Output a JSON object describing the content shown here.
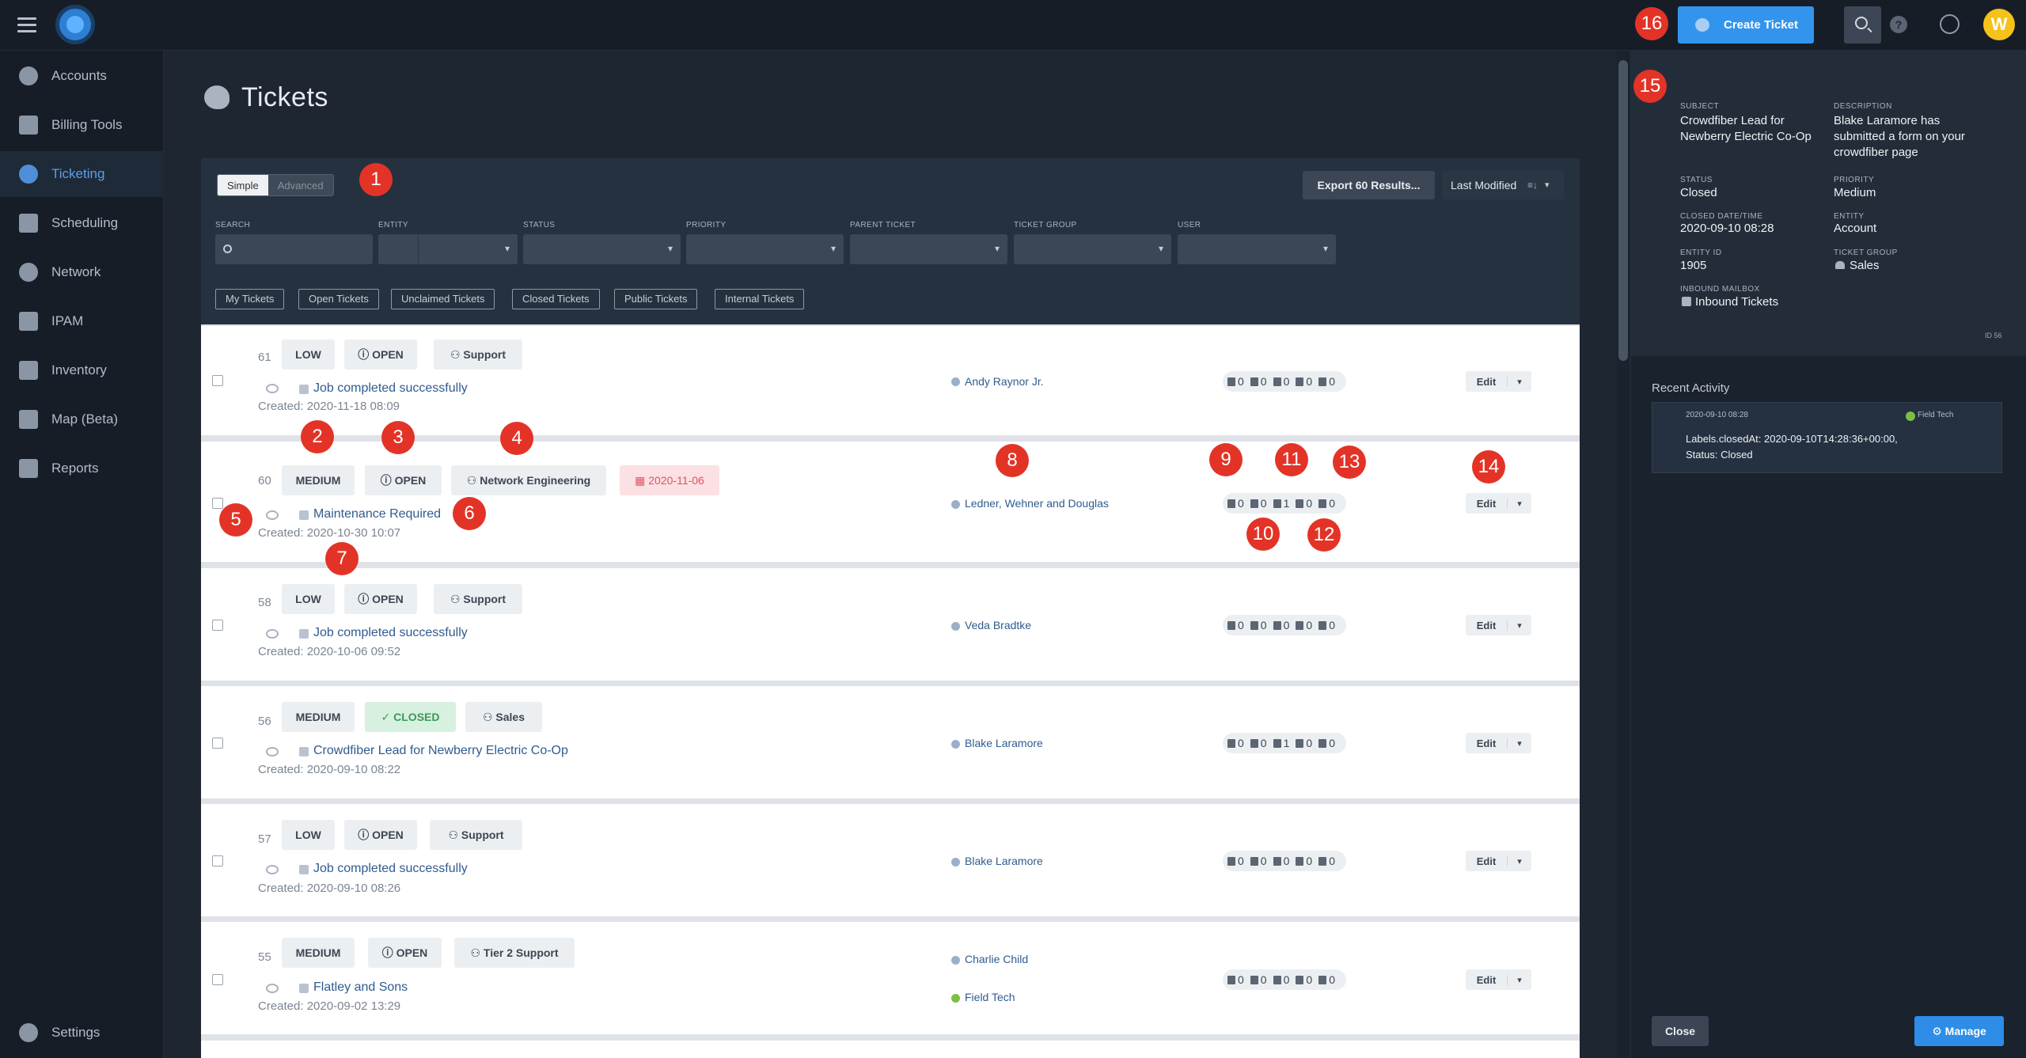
{
  "sidebar": {
    "items": [
      {
        "label": "Accounts",
        "icon": "accounts-icon"
      },
      {
        "label": "Billing Tools",
        "icon": "billing-icon"
      },
      {
        "label": "Ticketing",
        "icon": "ticketing-icon",
        "active": true
      },
      {
        "label": "Scheduling",
        "icon": "calendar-icon"
      },
      {
        "label": "Network",
        "icon": "network-icon"
      },
      {
        "label": "IPAM",
        "icon": "ipam-icon"
      },
      {
        "label": "Inventory",
        "icon": "inventory-icon"
      },
      {
        "label": "Map (Beta)",
        "icon": "map-icon"
      },
      {
        "label": "Reports",
        "icon": "reports-icon"
      }
    ],
    "settings_label": "Settings"
  },
  "header": {
    "create_label": "Create Ticket",
    "avatar_initial": "W"
  },
  "page": {
    "title": "Tickets"
  },
  "filters": {
    "mode_simple": "Simple",
    "mode_advanced": "Advanced",
    "export_label": "Export 60 Results...",
    "sort_label": "Last Modified",
    "labels": [
      "SEARCH",
      "ENTITY",
      "STATUS",
      "PRIORITY",
      "PARENT TICKET",
      "TICKET GROUP",
      "USER"
    ],
    "chips": [
      "My Tickets",
      "Open Tickets",
      "Unclaimed Tickets",
      "Closed Tickets",
      "Public Tickets",
      "Internal Tickets"
    ]
  },
  "tickets": [
    {
      "id": "61",
      "priority": "LOW",
      "status": "OPEN",
      "group": "Support",
      "subject": "Job completed successfully",
      "created": "Created: 2020-11-18 08:09",
      "assignee": "Andy Raynor Jr.",
      "counts": [
        "0",
        "0",
        "0",
        "0",
        "0"
      ]
    },
    {
      "id": "60",
      "priority": "MEDIUM",
      "status": "OPEN",
      "group": "Network Engineering",
      "due": "2020-11-06",
      "subject": "Maintenance Required",
      "created": "Created: 2020-10-30 10:07",
      "assignee": "Ledner, Wehner and Douglas",
      "counts": [
        "0",
        "0",
        "1",
        "0",
        "0"
      ]
    },
    {
      "id": "58",
      "priority": "LOW",
      "status": "OPEN",
      "group": "Support",
      "subject": "Job completed successfully",
      "created": "Created: 2020-10-06 09:52",
      "assignee": "Veda Bradtke",
      "counts": [
        "0",
        "0",
        "0",
        "0",
        "0"
      ]
    },
    {
      "id": "56",
      "priority": "MEDIUM",
      "status": "CLOSED",
      "group": "Sales",
      "subject": "Crowdfiber Lead for Newberry Electric Co-Op",
      "created": "Created: 2020-09-10 08:22",
      "assignee": "Blake Laramore",
      "counts": [
        "0",
        "0",
        "1",
        "0",
        "0"
      ]
    },
    {
      "id": "57",
      "priority": "LOW",
      "status": "OPEN",
      "group": "Support",
      "subject": "Job completed successfully",
      "created": "Created: 2020-09-10 08:26",
      "assignee": "Blake Laramore",
      "counts": [
        "0",
        "0",
        "0",
        "0",
        "0"
      ]
    },
    {
      "id": "55",
      "priority": "MEDIUM",
      "status": "OPEN",
      "group": "Tier 2 Support",
      "subject": "Flatley and Sons",
      "created": "Created: 2020-09-02 13:29",
      "assignee": "Charlie Child",
      "assignee2": "Field Tech",
      "counts": [
        "0",
        "0",
        "0",
        "0",
        "0"
      ]
    }
  ],
  "edit_label": "Edit",
  "annotations": [
    "1",
    "2",
    "3",
    "4",
    "5",
    "6",
    "7",
    "8",
    "9",
    "10",
    "11",
    "12",
    "13",
    "14",
    "15",
    "16"
  ],
  "detail": {
    "subject_label": "SUBJECT",
    "subject": "Crowdfiber Lead for Newberry Electric Co-Op",
    "description_label": "DESCRIPTION",
    "description": "Blake Laramore has submitted a form on your crowdfiber page",
    "status_label": "STATUS",
    "status": "Closed",
    "priority_label": "PRIORITY",
    "priority": "Medium",
    "closed_label": "CLOSED DATE/TIME",
    "closed": "2020-09-10 08:28",
    "entity_label": "ENTITY",
    "entity": "Account",
    "entity_id_label": "ENTITY ID",
    "entity_id": "1905",
    "group_label": "TICKET GROUP",
    "group": "Sales",
    "mailbox_label": "INBOUND MAILBOX",
    "mailbox": "Inbound Tickets",
    "id_text": "ID 56",
    "activity_title": "Recent Activity",
    "activity_time": "2020-09-10 08:28",
    "activity_user": "Field Tech",
    "activity_line1": "Labels.closedAt: 2020-09-10T14:28:36+00:00,",
    "activity_line2": "Status: Closed",
    "close_label": "Close",
    "manage_label": "Manage"
  }
}
